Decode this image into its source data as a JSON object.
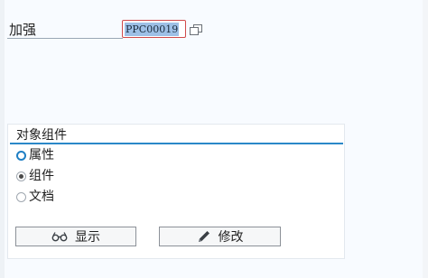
{
  "field": {
    "label": "加强",
    "value": "PPC00019"
  },
  "group": {
    "title": "对象组件",
    "options": [
      {
        "label": "属性",
        "selected": false,
        "focused": true
      },
      {
        "label": "组件",
        "selected": true,
        "focused": false
      },
      {
        "label": "文档",
        "selected": false,
        "focused": false
      }
    ]
  },
  "buttons": {
    "display_label": "显示",
    "change_label": "修改"
  },
  "colors": {
    "accent": "#2a88c8",
    "selection": "#9ec0e6",
    "required_border": "#d04a4a"
  },
  "icons": {
    "display": "glasses-icon",
    "change": "pencil-icon",
    "f4_help": "value-help-icon"
  }
}
